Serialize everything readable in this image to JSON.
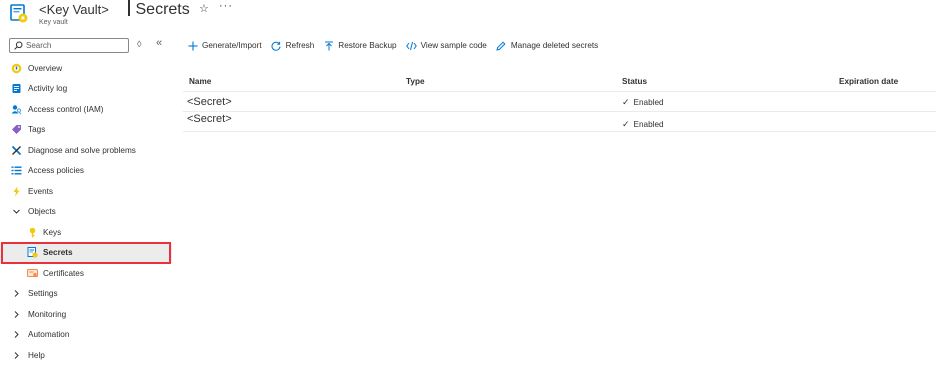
{
  "header": {
    "resource_name": "<Key Vault>",
    "resource_type": "Key vault",
    "page_title": "Secrets",
    "favorite_glyph": "☆",
    "more_glyph": "···"
  },
  "search": {
    "placeholder": "Search"
  },
  "sidebar": {
    "collapse_glyph": "«",
    "expand_glyph": "◊",
    "items": [
      {
        "label": "Overview",
        "icon": "overview-icon",
        "color": "#f2c811"
      },
      {
        "label": "Activity log",
        "icon": "activity-log-icon",
        "color": "#0078d4"
      },
      {
        "label": "Access control (IAM)",
        "icon": "access-control-icon",
        "color": "#0078d4"
      },
      {
        "label": "Tags",
        "icon": "tag-icon",
        "color": "#8661c5"
      },
      {
        "label": "Diagnose and solve problems",
        "icon": "wrench-icon",
        "color": "#0078d4"
      },
      {
        "label": "Access policies",
        "icon": "list-icon",
        "color": "#0078d4"
      },
      {
        "label": "Events",
        "icon": "lightning-icon",
        "color": "#f2c811"
      },
      {
        "label": "Objects",
        "icon": "chevron-down-icon",
        "color": "#323130"
      },
      {
        "label": "Keys",
        "icon": "key-icon",
        "color": "#f2c811"
      },
      {
        "label": "Secrets",
        "icon": "secret-icon",
        "color": "#0078d4"
      },
      {
        "label": "Certificates",
        "icon": "certificate-icon",
        "color": "#f7894a"
      },
      {
        "label": "Settings",
        "icon": "chevron-right-icon",
        "color": "#323130"
      },
      {
        "label": "Monitoring",
        "icon": "chevron-right-icon",
        "color": "#323130"
      },
      {
        "label": "Automation",
        "icon": "chevron-right-icon",
        "color": "#323130"
      },
      {
        "label": "Help",
        "icon": "chevron-right-icon",
        "color": "#323130"
      }
    ],
    "selected_color": "#e8313a"
  },
  "toolbar": {
    "generate_label": "Generate/Import",
    "refresh_label": "Refresh",
    "restore_label": "Restore Backup",
    "sample_label": "View sample code",
    "deleted_label": "Manage deleted secrets"
  },
  "table": {
    "columns": [
      "Name",
      "Type",
      "Status",
      "Expiration date"
    ],
    "rows": [
      {
        "name": "<Secret>",
        "type": "",
        "status": "Enabled",
        "expiration": ""
      },
      {
        "name": "<Secret>",
        "type": "",
        "status": "Enabled",
        "expiration": ""
      }
    ]
  }
}
